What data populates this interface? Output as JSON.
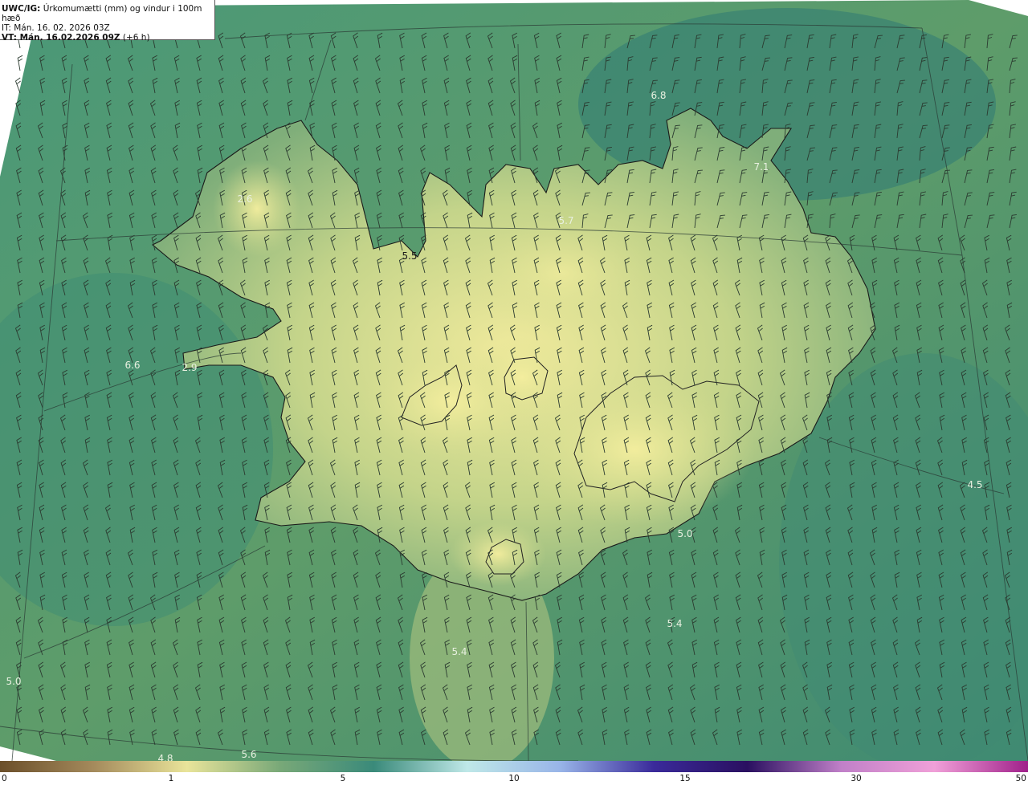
{
  "header": {
    "product": "UWC/IG:",
    "title": "Úrkomumætti (mm) og vindur i 100m hæð",
    "it_line": "IT: Mán. 16. 02. 2026 03Z",
    "vt_bold": "VT: Mán. 16.02.2026 09Z",
    "vt_lead": "(+6 h)"
  },
  "value_labels": [
    "6.8",
    "7.1",
    "2.6",
    "5.5",
    "5.7",
    "6.6",
    "2.9",
    "5.0",
    "4.5",
    "5.4",
    "5.4",
    "5.0",
    "4.8",
    "5.6"
  ],
  "colorbar": {
    "ticks": [
      "0",
      "1",
      "5",
      "10",
      "15",
      "30",
      "50"
    ],
    "colors": [
      "#6b4f2a",
      "#a48a5c",
      "#e9e49a",
      "#78a878",
      "#3a8a7a",
      "#bfe8e8",
      "#98b4e8",
      "#3a2a9a",
      "#2a1060",
      "#c080c8",
      "#f0a0d8",
      "#a0208a"
    ]
  },
  "map": {
    "ocean_color": "#3f8a6e",
    "land_color": "#c8d688",
    "high_color": "#f0ea9c"
  }
}
